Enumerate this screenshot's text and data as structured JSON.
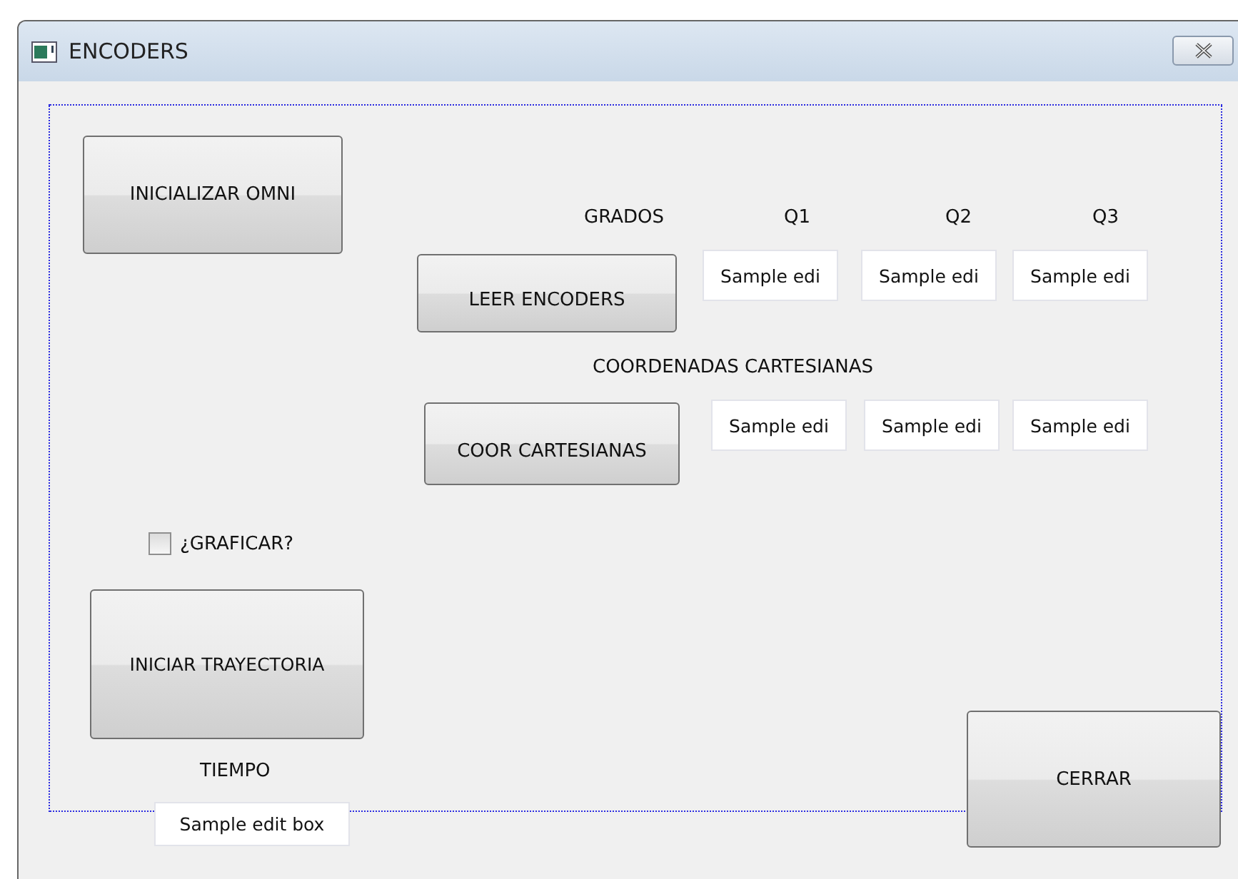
{
  "window": {
    "title": "ENCODERS"
  },
  "buttons": {
    "init_omni": "INICIALIZAR OMNI",
    "read_encoders": "LEER ENCODERS",
    "cartesian": "COOR CARTESIANAS",
    "start_trajectory": "INICIAR TRAYECTORIA",
    "close": "CERRAR"
  },
  "labels": {
    "degrees": "GRADOS",
    "q1": "Q1",
    "q2": "Q2",
    "q3": "Q3",
    "cartesian_coordinates": "COORDENADAS CARTESIANAS",
    "time": "TIEMPO"
  },
  "degree_fields": [
    {
      "value": "Sample edi"
    },
    {
      "value": "Sample edi"
    },
    {
      "value": "Sample edi"
    }
  ],
  "cartesian_fields": [
    {
      "value": "Sample edi"
    },
    {
      "value": "Sample edi"
    },
    {
      "value": "Sample edi"
    }
  ],
  "plot_checkbox": {
    "label": "¿GRAFICAR?",
    "checked": false
  },
  "time_field": {
    "value": "Sample edit box"
  }
}
